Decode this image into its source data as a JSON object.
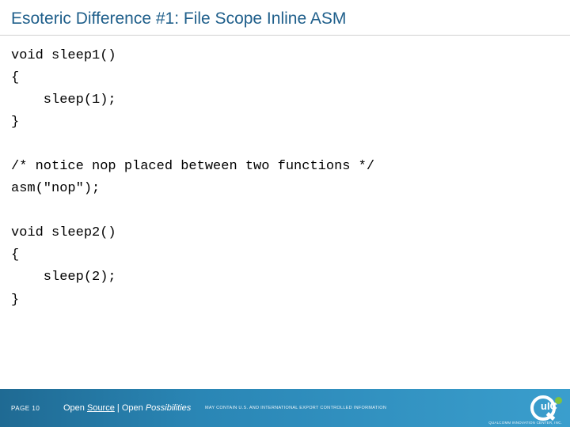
{
  "title": "Esoteric Difference #1: File Scope Inline ASM",
  "code": "void sleep1()\n{\n    sleep(1);\n}\n\n/* notice nop placed between two functions */\nasm(\"nop\");\n\nvoid sleep2()\n{\n    sleep(2);\n}",
  "footer": {
    "page_label": "PAGE",
    "page_number": "10",
    "tagline_open": "Open",
    "tagline_source": "Source",
    "tagline_sep": " | ",
    "tagline_open2": "Open",
    "tagline_poss": "Possibilities",
    "disclaimer": "MAY CONTAIN U.S. AND INTERNATIONAL EXPORT CONTROLLED INFORMATION",
    "logo_text": "uIC",
    "logo_sub": "QUALCOMM INNOVATION CENTER, INC."
  }
}
